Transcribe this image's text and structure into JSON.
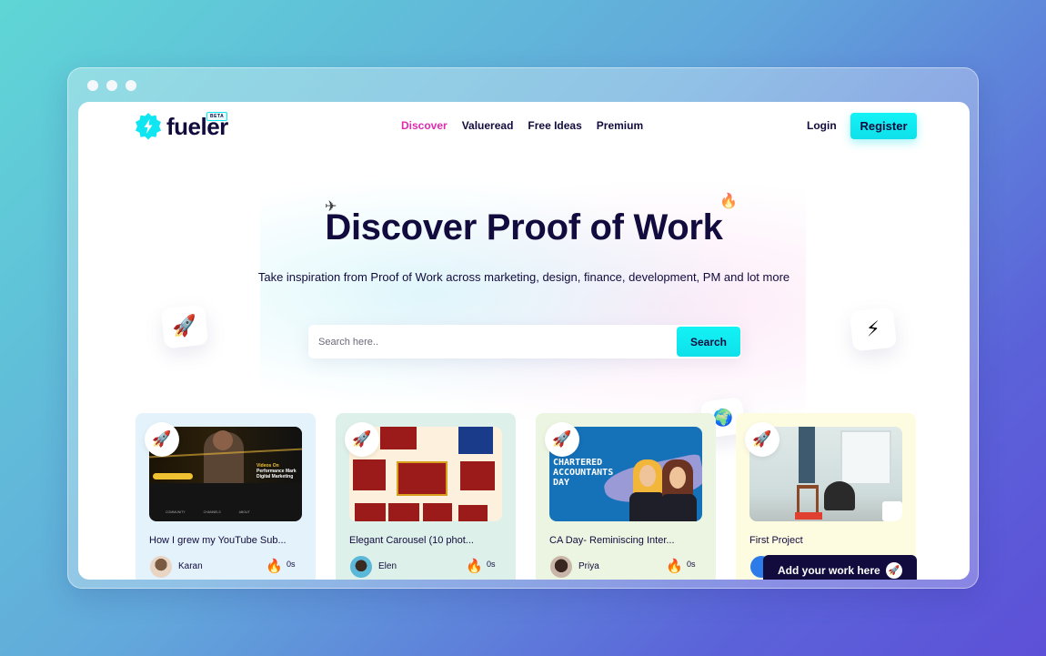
{
  "window": {
    "controls": [
      "close",
      "minimize",
      "maximize"
    ]
  },
  "brand": {
    "name": "fueler",
    "badge": "BETA",
    "accent": "#12f3f6",
    "text_color": "#120b3e",
    "active_color": "#e02ab0"
  },
  "nav": {
    "links": [
      {
        "label": "Discover",
        "active": true
      },
      {
        "label": "Valueread",
        "active": false
      },
      {
        "label": "Free Ideas",
        "active": false
      },
      {
        "label": "Premium",
        "active": false
      }
    ],
    "login_label": "Login",
    "register_label": "Register"
  },
  "hero": {
    "title": "Discover Proof of Work",
    "subtitle": "Take inspiration from Proof of Work across marketing, design, finance, development, PM and lot more",
    "decorations": {
      "left_tile": "🚀",
      "right_tile": "⚡",
      "fire": "🔥",
      "plane": "✈",
      "globe": "🌍"
    }
  },
  "search": {
    "placeholder": "Search here..",
    "button_label": "Search"
  },
  "cards": [
    {
      "title": "How I grew my YouTube Sub...",
      "author": "Karan",
      "count": "0s",
      "badge": "🚀",
      "bg": "#e3f2fb"
    },
    {
      "title": "Elegant Carousel (10 phot...",
      "author": "Elen",
      "count": "0s",
      "badge": "🚀",
      "bg": "#ddf1ea"
    },
    {
      "title": "CA Day- Reminiscing Inter...",
      "author": "Priya",
      "count": "0s",
      "badge": "🚀",
      "bg": "#ecf5e1",
      "image_text": "CHARTERED ACCOUNTANTS DAY"
    },
    {
      "title": "First Project",
      "author": "",
      "count": "",
      "badge": "🚀",
      "bg": "#fdfbe0"
    }
  ],
  "card1_image": {
    "line1": "Videos On",
    "line2": "Performance Mark",
    "line3": "Digital Marketing",
    "tabs": [
      "COMMUNITY",
      "CHANNELS",
      "ABOUT"
    ]
  },
  "add_work": {
    "label": "Add your work here",
    "icon": "🚀"
  }
}
